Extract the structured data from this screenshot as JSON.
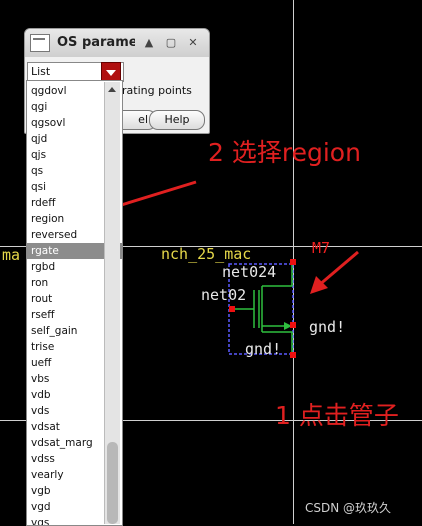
{
  "dialog": {
    "title": "OS parame",
    "dropdown_value": "List",
    "behind_label": "rating points",
    "cancel_label": "el",
    "help_label": "Help"
  },
  "list": {
    "items": [
      "qgdovl",
      "qgi",
      "qgsovl",
      "qjd",
      "qjs",
      "qs",
      "qsi",
      "rdeff",
      "region",
      "reversed",
      "rgate",
      "rgbd",
      "ron",
      "rout",
      "rseff",
      "self_gain",
      "trise",
      "ueff",
      "vbs",
      "vdb",
      "vds",
      "vdsat",
      "vdsat_marg",
      "vdss",
      "vearly",
      "vgb",
      "vgd",
      "vgs"
    ],
    "selected": "rgate"
  },
  "schematic": {
    "cell_name": "nch_25_mac",
    "instance": "M7",
    "net_top": "net024",
    "net_gate": "net02",
    "net_right": "gnd!",
    "net_bottom": "gnd!",
    "left_fragment": "ma"
  },
  "annotations": {
    "step2": "2 选择region",
    "step1": "1 点击管子"
  },
  "watermark": "CSDN @玖玖久"
}
